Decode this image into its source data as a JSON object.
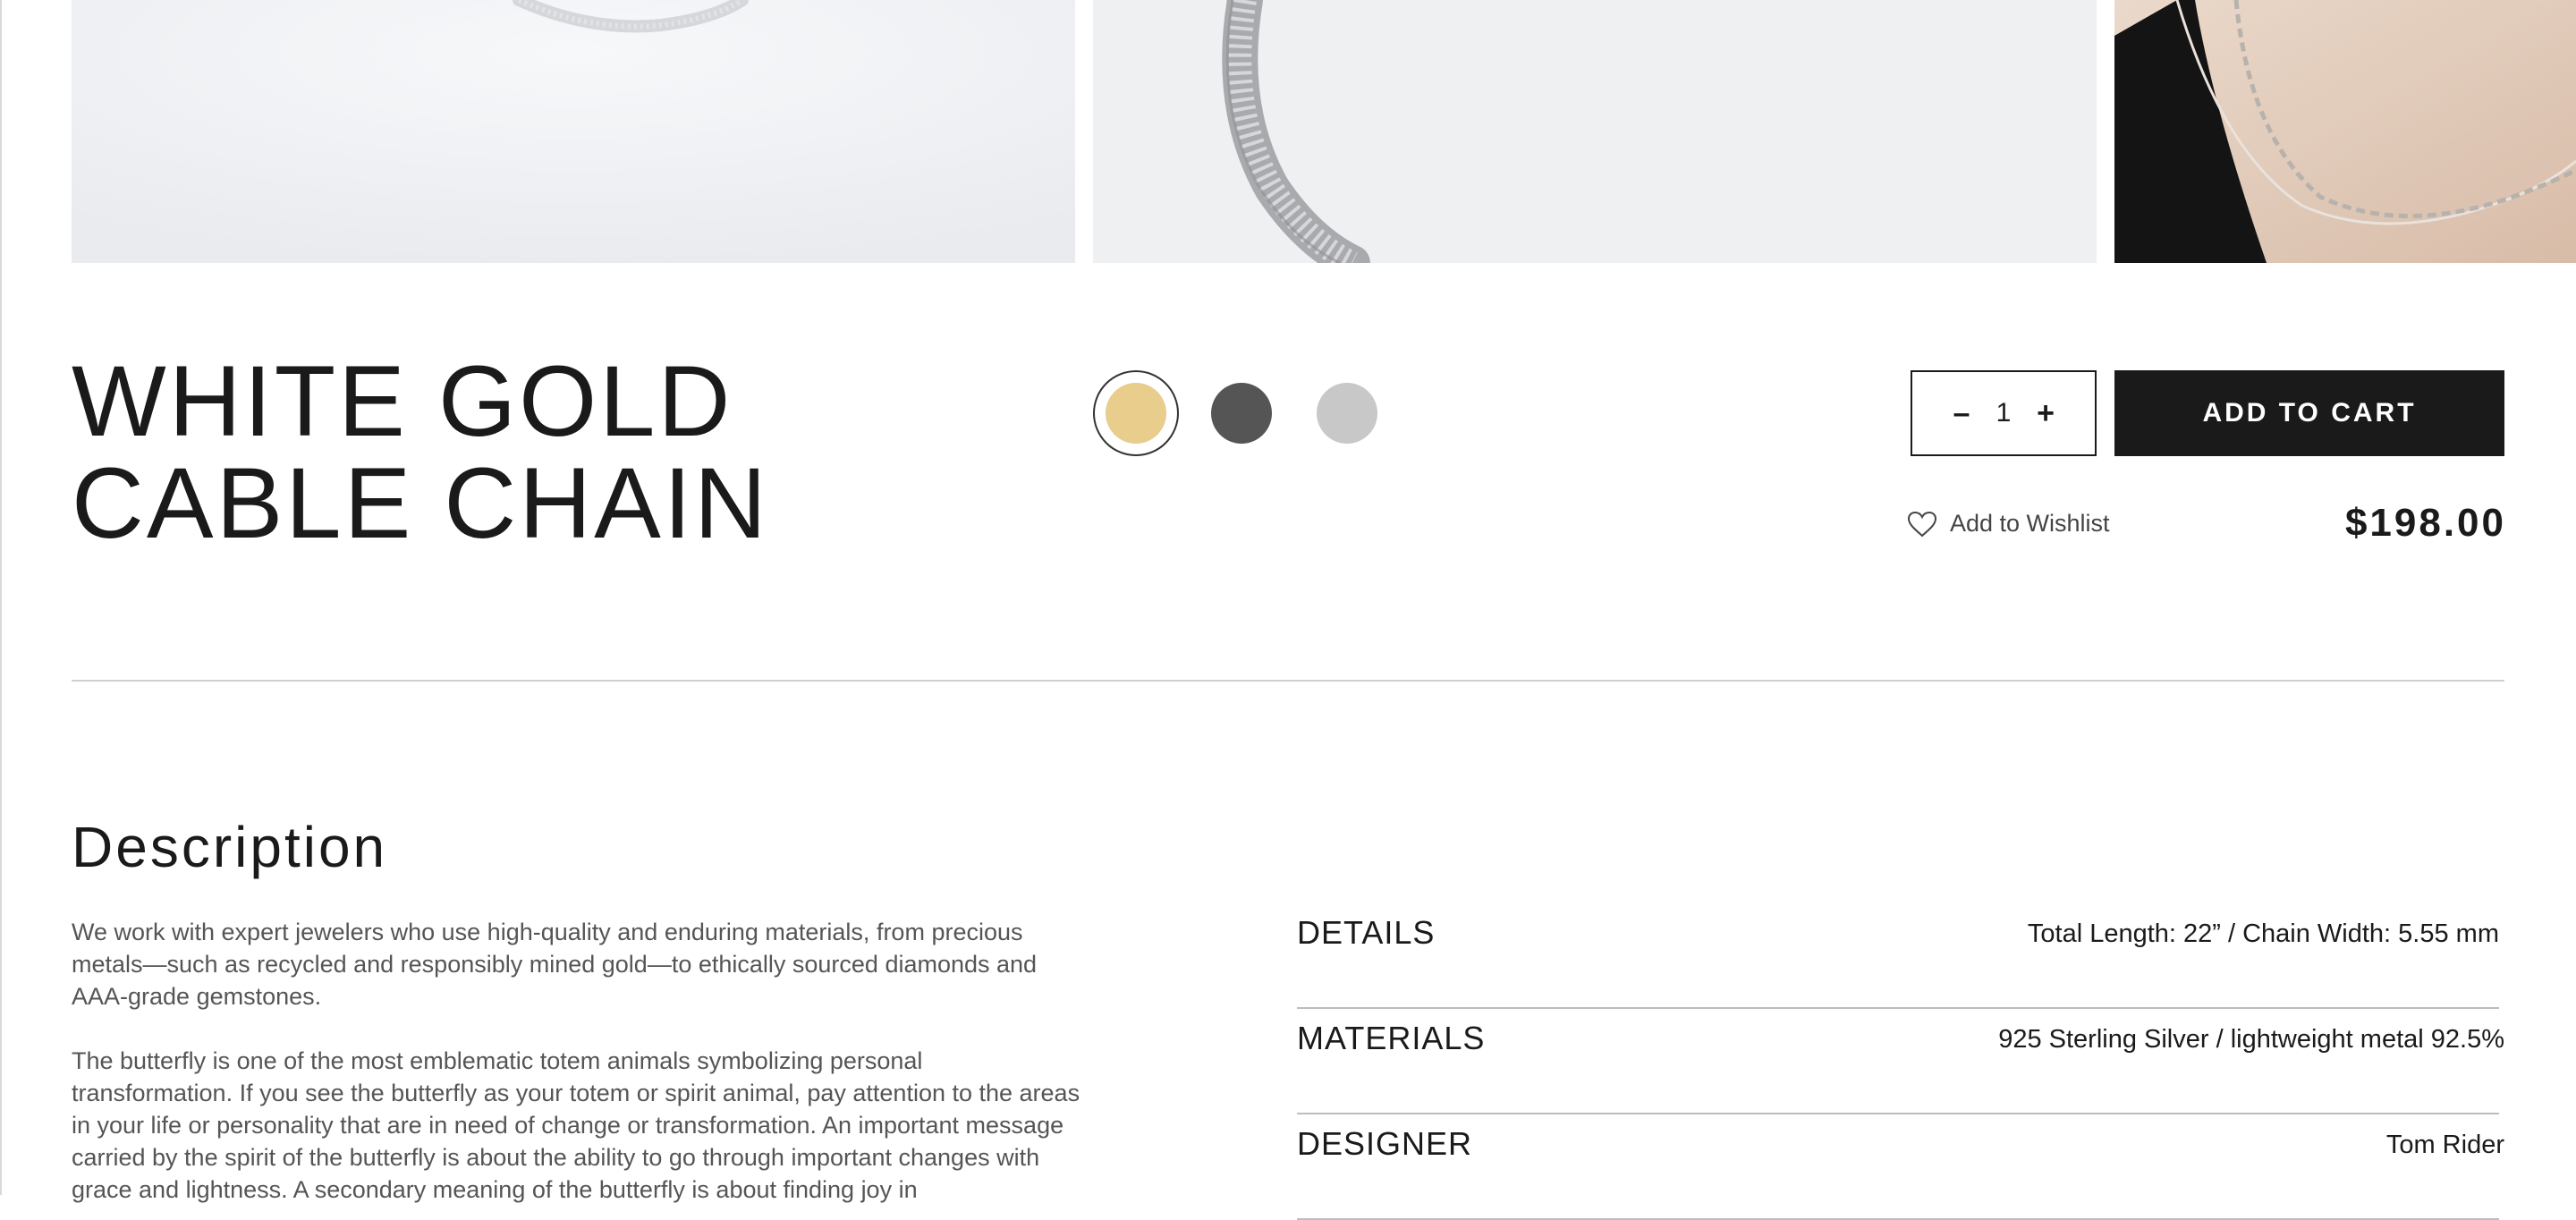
{
  "product": {
    "title_line1": "WHITE GOLD",
    "title_line2": "CABLE CHAIN",
    "price": "$198.00"
  },
  "swatches": [
    {
      "name": "gold",
      "color": "#e8cd8c",
      "selected": true
    },
    {
      "name": "dark-gray",
      "color": "#555555",
      "selected": false
    },
    {
      "name": "silver",
      "color": "#c8c8c8",
      "selected": false
    }
  ],
  "quantity": {
    "minus": "–",
    "value": "1",
    "plus": "+"
  },
  "actions": {
    "add_to_cart": "ADD TO CART",
    "wishlist": "Add to Wishlist"
  },
  "description": {
    "heading": "Description",
    "paragraph1": "We work with expert jewelers who use high-quality and enduring materials, from precious metals—such as recycled and responsibly mined gold—to ethically sourced diamonds and AAA-grade gemstones.",
    "paragraph2": "The butterfly is one of the most emblematic totem animals symbolizing personal transformation. If you see the butterfly as your totem or spirit animal, pay attention to the areas in your life or personality that are in need of change or transformation. An important message carried by the spirit of the butterfly is about the ability to go through important changes with grace and lightness. A secondary meaning of the butterfly is about finding joy in"
  },
  "specs": [
    {
      "label": "DETAILS",
      "value": "Total Length: 22” / Chain Width: 5.55 mm"
    },
    {
      "label": "MATERIALS",
      "value": "925 Sterling Silver / lightweight metal  92.5%"
    },
    {
      "label": "DESIGNER",
      "value": "Tom Rider"
    }
  ],
  "colors": {
    "primary": "#1a1a1a",
    "divider": "#cfcfcf"
  }
}
